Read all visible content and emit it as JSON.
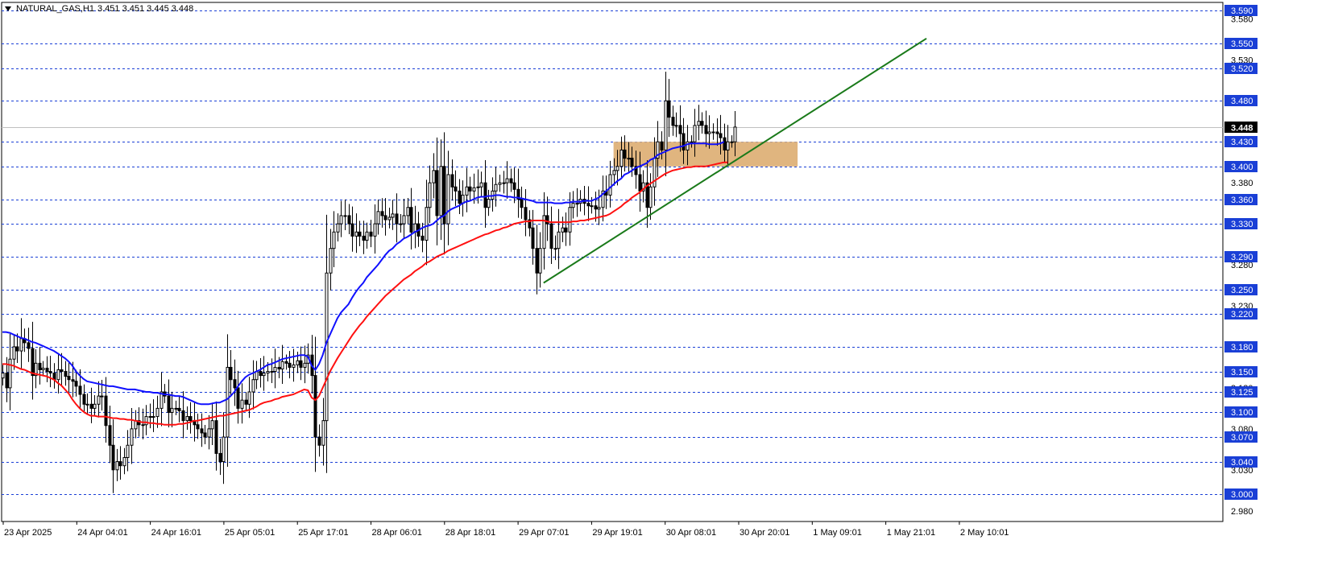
{
  "header": {
    "symbol_timeframe": "NATURAL_GAS,H1",
    "ohlc": "3.451 3.451 3.445 3.448"
  },
  "colors": {
    "background": "#ffffff",
    "candle_bull": "#ffffff",
    "candle_bear": "#000000",
    "level_line": "#1a3fd6",
    "label_bg": "#1a3fd6",
    "ma_fast": "#1010ff",
    "ma_slow": "#ff1010",
    "trendline": "#1a7a1a",
    "zone": "#e0b57f",
    "current_price_bg": "#000000"
  },
  "chart_data": {
    "type": "candlestick",
    "symbol": "NATURAL_GAS",
    "timeframe": "H1",
    "ylim": [
      2.967,
      3.6
    ],
    "y_ticks": [
      "3.580",
      "3.530",
      "3.380",
      "3.280",
      "3.230",
      "3.130",
      "3.080",
      "3.030",
      "2.980"
    ],
    "x_labels": [
      "23 Apr 2025",
      "24 Apr 04:01",
      "24 Apr 16:01",
      "25 Apr 05:01",
      "25 Apr 17:01",
      "28 Apr 06:01",
      "28 Apr 18:01",
      "29 Apr 07:01",
      "29 Apr 19:01",
      "30 Apr 08:01",
      "30 Apr 20:01",
      "1 May 09:01",
      "1 May 21:01",
      "2 May 10:01"
    ],
    "levels": [
      "3.590",
      "3.550",
      "3.520",
      "3.480",
      "3.430",
      "3.400",
      "3.360",
      "3.330",
      "3.290",
      "3.250",
      "3.220",
      "3.180",
      "3.150",
      "3.125",
      "3.100",
      "3.070",
      "3.040",
      "3.000"
    ],
    "current_price": "3.448",
    "zone": {
      "from_bar": 166,
      "to_bar": 216,
      "low": 3.4,
      "high": 3.43
    },
    "trendline": {
      "from": {
        "bar": 147,
        "price": 3.258
      },
      "to": {
        "bar": 251,
        "price": 3.556
      }
    },
    "close": [
      3.148,
      3.13,
      3.165,
      3.18,
      3.175,
      3.19,
      3.185,
      3.178,
      3.145,
      3.16,
      3.152,
      3.154,
      3.15,
      3.148,
      3.14,
      3.152,
      3.15,
      3.144,
      3.14,
      3.138,
      3.132,
      3.122,
      3.11,
      3.11,
      3.105,
      3.11,
      3.12,
      3.12,
      3.084,
      3.06,
      3.03,
      3.04,
      3.035,
      3.045,
      3.06,
      3.08,
      3.09,
      3.085,
      3.085,
      3.095,
      3.095,
      3.095,
      3.105,
      3.125,
      3.12,
      3.1,
      3.105,
      3.105,
      3.102,
      3.09,
      3.095,
      3.09,
      3.085,
      3.08,
      3.075,
      3.07,
      3.08,
      3.09,
      3.05,
      3.04,
      3.07,
      3.155,
      3.14,
      3.13,
      3.105,
      3.115,
      3.11,
      3.125,
      3.14,
      3.15,
      3.145,
      3.148,
      3.15,
      3.15,
      3.155,
      3.153,
      3.162,
      3.16,
      3.155,
      3.158,
      3.163,
      3.155,
      3.16,
      3.17,
      3.145,
      3.07,
      3.06,
      3.09,
      3.27,
      3.3,
      3.32,
      3.33,
      3.34,
      3.34,
      3.33,
      3.315,
      3.32,
      3.315,
      3.31,
      3.32,
      3.315,
      3.33,
      3.345,
      3.34,
      3.335,
      3.338,
      3.342,
      3.33,
      3.33,
      3.34,
      3.35,
      3.32,
      3.33,
      3.315,
      3.31,
      3.35,
      3.38,
      3.395,
      3.34,
      3.4,
      3.33,
      3.39,
      3.375,
      3.37,
      3.355,
      3.365,
      3.375,
      3.37,
      3.374,
      3.375,
      3.38,
      3.35,
      3.36,
      3.37,
      3.378,
      3.38,
      3.38,
      3.385,
      3.38,
      3.372,
      3.36,
      3.35,
      3.335,
      3.325,
      3.3,
      3.27,
      3.3,
      3.34,
      3.33,
      3.3,
      3.3,
      3.32,
      3.325,
      3.32,
      3.35,
      3.355,
      3.355,
      3.36,
      3.355,
      3.352,
      3.352,
      3.348,
      3.35,
      3.37,
      3.365,
      3.39,
      3.395,
      3.4,
      3.42,
      3.41,
      3.41,
      3.4,
      3.39,
      3.37,
      3.38,
      3.35,
      3.375,
      3.41,
      3.43,
      3.42,
      3.48,
      3.46,
      3.45,
      3.45,
      3.44,
      3.42,
      3.43,
      3.43,
      3.45,
      3.455,
      3.45,
      3.44,
      3.442,
      3.442,
      3.44,
      3.435,
      3.42,
      3.43,
      3.43,
      3.448
    ],
    "ma_fast": [
      3.198,
      3.198,
      3.197,
      3.195,
      3.193,
      3.191,
      3.19,
      3.188,
      3.186,
      3.185,
      3.183,
      3.181,
      3.179,
      3.177,
      3.175,
      3.172,
      3.169,
      3.166,
      3.162,
      3.157,
      3.15,
      3.145,
      3.141,
      3.138,
      3.137,
      3.136,
      3.135,
      3.134,
      3.133,
      3.132,
      3.132,
      3.131,
      3.13,
      3.129,
      3.128,
      3.128,
      3.128,
      3.127,
      3.126,
      3.125,
      3.125,
      3.124,
      3.124,
      3.123,
      3.122,
      3.122,
      3.121,
      3.12,
      3.12,
      3.119,
      3.117,
      3.115,
      3.113,
      3.111,
      3.11,
      3.11,
      3.11,
      3.111,
      3.112,
      3.112,
      3.114,
      3.116,
      3.12,
      3.125,
      3.132,
      3.138,
      3.143,
      3.146,
      3.148,
      3.15,
      3.152,
      3.155,
      3.158,
      3.159,
      3.161,
      3.163,
      3.165,
      3.166,
      3.167,
      3.168,
      3.169,
      3.17,
      3.17,
      3.168,
      3.157,
      3.152,
      3.159,
      3.17,
      3.185,
      3.195,
      3.205,
      3.215,
      3.222,
      3.227,
      3.232,
      3.24,
      3.247,
      3.253,
      3.258,
      3.265,
      3.27,
      3.275,
      3.28,
      3.286,
      3.292,
      3.297,
      3.3,
      3.305,
      3.308,
      3.312,
      3.314,
      3.317,
      3.32,
      3.322,
      3.325,
      3.327,
      3.328,
      3.33,
      3.334,
      3.338,
      3.34,
      3.345,
      3.348,
      3.35,
      3.352,
      3.355,
      3.357,
      3.358,
      3.36,
      3.362,
      3.363,
      3.363,
      3.364,
      3.364,
      3.365,
      3.365,
      3.364,
      3.363,
      3.363,
      3.362,
      3.362,
      3.361,
      3.36,
      3.359,
      3.358,
      3.356,
      3.356,
      3.356,
      3.356,
      3.356,
      3.355,
      3.355,
      3.355,
      3.356,
      3.356,
      3.357,
      3.357,
      3.357,
      3.358,
      3.358,
      3.358,
      3.36,
      3.362,
      3.366,
      3.37,
      3.374,
      3.378,
      3.382,
      3.385,
      3.39,
      3.392,
      3.395,
      3.398,
      3.4,
      3.402,
      3.404,
      3.408,
      3.41,
      3.414,
      3.416,
      3.418,
      3.42,
      3.422,
      3.423,
      3.424,
      3.425,
      3.427,
      3.428,
      3.428,
      3.428,
      3.428,
      3.428,
      3.427,
      3.427,
      3.427,
      3.428,
      3.43
    ],
    "ma_slow": [
      3.159,
      3.159,
      3.158,
      3.157,
      3.155,
      3.153,
      3.152,
      3.15,
      3.148,
      3.147,
      3.146,
      3.145,
      3.144,
      3.142,
      3.14,
      3.136,
      3.133,
      3.128,
      3.123,
      3.116,
      3.11,
      3.105,
      3.101,
      3.098,
      3.096,
      3.096,
      3.095,
      3.095,
      3.095,
      3.094,
      3.093,
      3.093,
      3.092,
      3.092,
      3.091,
      3.091,
      3.09,
      3.089,
      3.088,
      3.088,
      3.087,
      3.087,
      3.086,
      3.086,
      3.085,
      3.085,
      3.085,
      3.085,
      3.086,
      3.086,
      3.087,
      3.088,
      3.09,
      3.09,
      3.091,
      3.092,
      3.093,
      3.094,
      3.095,
      3.096,
      3.096,
      3.097,
      3.098,
      3.099,
      3.1,
      3.101,
      3.102,
      3.103,
      3.105,
      3.107,
      3.11,
      3.112,
      3.113,
      3.114,
      3.116,
      3.117,
      3.119,
      3.12,
      3.121,
      3.122,
      3.124,
      3.126,
      3.128,
      3.127,
      3.118,
      3.115,
      3.12,
      3.13,
      3.14,
      3.15,
      3.158,
      3.166,
      3.173,
      3.18,
      3.187,
      3.194,
      3.2,
      3.206,
      3.211,
      3.217,
      3.222,
      3.227,
      3.232,
      3.237,
      3.242,
      3.246,
      3.25,
      3.254,
      3.258,
      3.262,
      3.265,
      3.268,
      3.272,
      3.275,
      3.278,
      3.282,
      3.284,
      3.287,
      3.29,
      3.292,
      3.294,
      3.297,
      3.299,
      3.301,
      3.303,
      3.305,
      3.307,
      3.309,
      3.311,
      3.313,
      3.315,
      3.317,
      3.318,
      3.32,
      3.322,
      3.323,
      3.325,
      3.326,
      3.328,
      3.33,
      3.331,
      3.332,
      3.333,
      3.333,
      3.334,
      3.334,
      3.334,
      3.334,
      3.333,
      3.332,
      3.332,
      3.332,
      3.332,
      3.332,
      3.332,
      3.333,
      3.333,
      3.334,
      3.334,
      3.335,
      3.336,
      3.337,
      3.338,
      3.339,
      3.34,
      3.342,
      3.345,
      3.348,
      3.351,
      3.355,
      3.358,
      3.362,
      3.365,
      3.368,
      3.372,
      3.376,
      3.379,
      3.382,
      3.385,
      3.388,
      3.391,
      3.393,
      3.395,
      3.396,
      3.397,
      3.398,
      3.399,
      3.399,
      3.4,
      3.4,
      3.4,
      3.4,
      3.401,
      3.402,
      3.403,
      3.404,
      3.405,
      3.405
    ]
  }
}
